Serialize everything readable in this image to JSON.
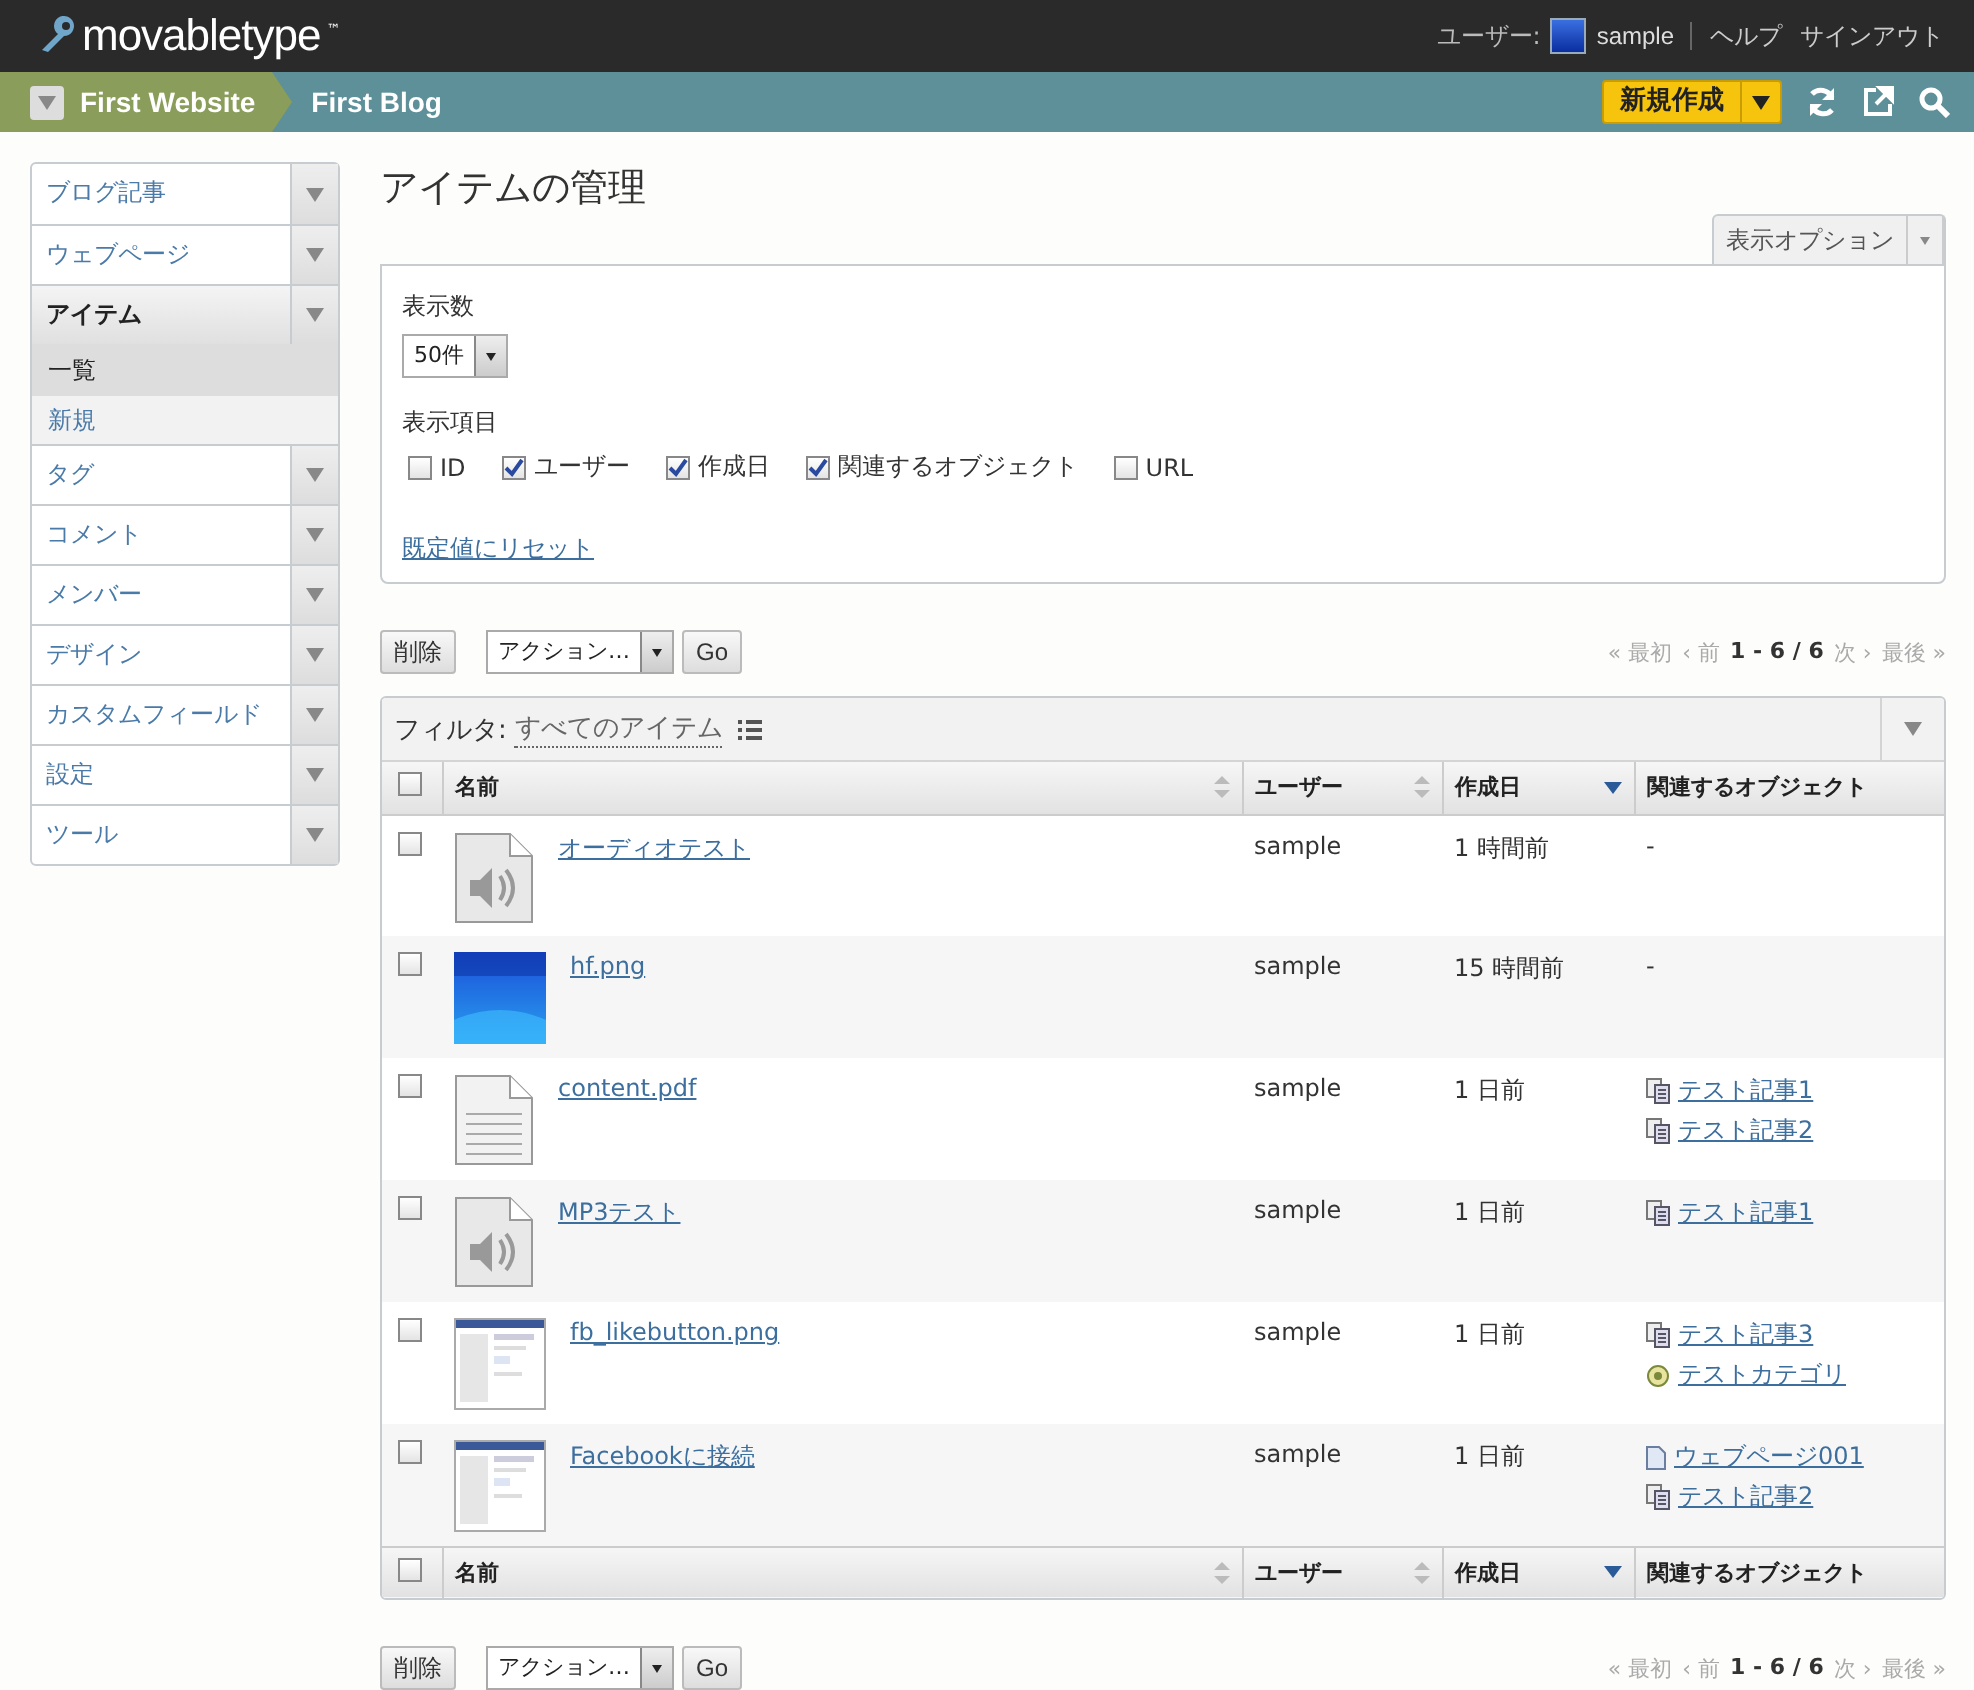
{
  "header": {
    "logo": "movabletype",
    "logo_mark": "™",
    "user_label": "ユーザー:",
    "user_name": "sample",
    "links": [
      "ヘルプ",
      "サインアウト"
    ]
  },
  "breadcrumb": [
    "First Website",
    "First Blog"
  ],
  "new_button": "新規作成",
  "sidebar": {
    "items": [
      {
        "label": "ブログ記事",
        "selected": false
      },
      {
        "label": "ウェブページ",
        "selected": false
      },
      {
        "label": "アイテム",
        "selected": true,
        "children": [
          {
            "label": "一覧",
            "selected": true
          },
          {
            "label": "新規",
            "selected": false
          }
        ]
      },
      {
        "label": "タグ",
        "selected": false
      },
      {
        "label": "コメント",
        "selected": false
      },
      {
        "label": "メンバー",
        "selected": false
      },
      {
        "label": "デザイン",
        "selected": false
      },
      {
        "label": "カスタムフィールド",
        "selected": false
      },
      {
        "label": "設定",
        "selected": false
      },
      {
        "label": "ツール",
        "selected": false
      }
    ]
  },
  "page_title": "アイテムの管理",
  "display_options": {
    "label": "表示オプション",
    "count_label": "表示数",
    "count_value": "50件",
    "columns_label": "表示項目",
    "columns": [
      {
        "label": "ID",
        "checked": false
      },
      {
        "label": "ユーザー",
        "checked": true
      },
      {
        "label": "作成日",
        "checked": true
      },
      {
        "label": "関連するオブジェクト",
        "checked": true
      },
      {
        "label": "URL",
        "checked": false
      }
    ],
    "reset": "既定値にリセット"
  },
  "toolbars": [
    {
      "delete": "削除",
      "action": "アクション…",
      "go": "Go",
      "pager": {
        "first": "« 最初",
        "prev": "‹ 前",
        "range": "1 - 6 / 6",
        "next": "次 ›",
        "last": "最後 »"
      }
    },
    {
      "delete": "削除",
      "action": "アクション…",
      "go": "Go",
      "pager": {
        "first": "« 最初",
        "prev": "‹ 前",
        "range": "1 - 6 / 6",
        "next": "次 ›",
        "last": "最後 »"
      }
    }
  ],
  "table": {
    "filter_label": "フィルタ:",
    "filter_value": "すべてのアイテム",
    "header": {
      "checked": false,
      "columns": [
        {
          "label": "名前",
          "kind": "sortable"
        },
        {
          "label": "ユーザー",
          "kind": "sortable"
        },
        {
          "label": "作成日",
          "kind": "descending"
        },
        {
          "label": "関連するオブジェクト",
          "kind": "plain"
        }
      ]
    },
    "rows": [
      {
        "checked": false,
        "kind": "audio",
        "name": "オーディオテスト",
        "user": "sample",
        "created": "1 時間前",
        "related": [
          {
            "kind": "none",
            "label": "-"
          }
        ]
      },
      {
        "checked": false,
        "name": "hf.png",
        "user": "sample",
        "created": "15 時間前",
        "related": [
          {
            "kind": "none",
            "label": "-"
          }
        ]
      },
      {
        "checked": false,
        "kind": "document",
        "name": "content.pdf",
        "user": "sample",
        "created": "1 日前",
        "related": [
          {
            "kind": "entry",
            "label": "テスト記事1"
          },
          {
            "kind": "entry",
            "label": "テスト記事2"
          }
        ]
      },
      {
        "checked": false,
        "kind": "audio",
        "name": "MP3テスト",
        "user": "sample",
        "created": "1 日前",
        "related": [
          {
            "kind": "entry",
            "label": "テスト記事1"
          }
        ]
      },
      {
        "checked": false,
        "kind": "screenshot",
        "name": "fb_likebutton.png",
        "user": "sample",
        "created": "1 日前",
        "related": [
          {
            "kind": "entry",
            "label": "テスト記事3"
          },
          {
            "kind": "category",
            "label": "テストカテゴリ"
          }
        ]
      },
      {
        "checked": false,
        "kind": "screenshot",
        "name": "Facebookに接続",
        "user": "sample",
        "created": "1 日前",
        "related": [
          {
            "kind": "page",
            "label": "ウェブページ001"
          },
          {
            "kind": "entry",
            "label": "テスト記事2"
          }
        ]
      }
    ],
    "footer": {
      "checked": false,
      "columns": [
        {
          "label": "名前",
          "kind": "sortable"
        },
        {
          "label": "ユーザー",
          "kind": "sortable"
        },
        {
          "label": "作成日",
          "kind": "descending"
        },
        {
          "label": "関連するオブジェクト",
          "kind": "plain"
        }
      ]
    }
  }
}
